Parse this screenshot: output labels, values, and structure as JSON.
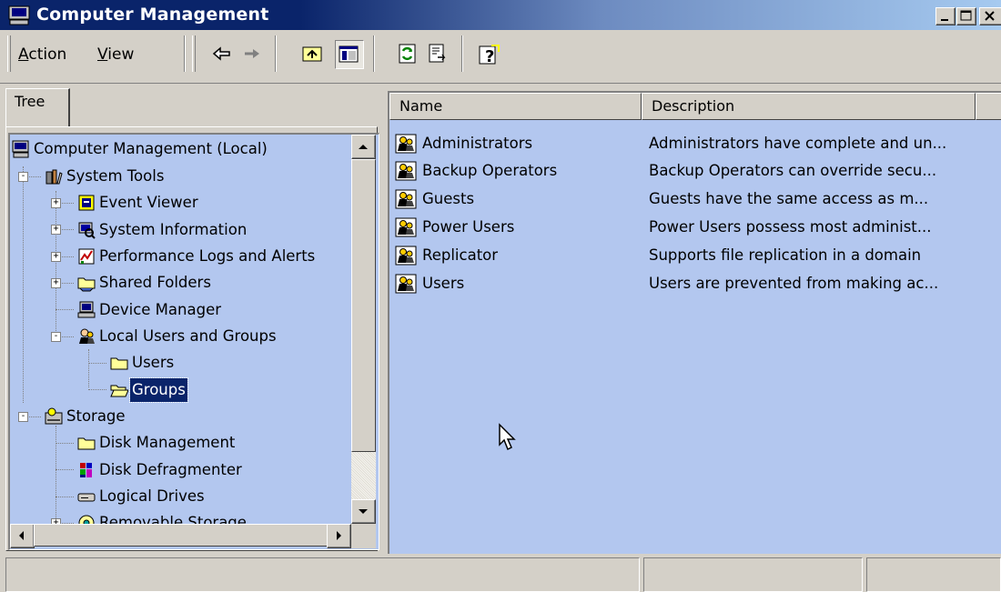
{
  "window": {
    "title": "Computer Management",
    "icon": "computer-icon",
    "caption_buttons": [
      "minimize",
      "maximize",
      "close"
    ]
  },
  "toolbar": {
    "menu": [
      {
        "label": "Action",
        "accel": "A"
      },
      {
        "label": "View",
        "accel": "V"
      }
    ],
    "buttons": [
      "back-icon",
      "forward-icon",
      "up-folder-icon",
      "show-hide-tree-icon",
      "refresh-icon",
      "export-list-icon",
      "help-icon"
    ],
    "pressed": "show-hide-tree-icon"
  },
  "tree": {
    "tab_label": "Tree",
    "items": [
      {
        "label": "Computer Management (Local)",
        "icon": "computer-icon",
        "level": 0
      },
      {
        "label": "System Tools",
        "icon": "system-tools-icon",
        "level": 1,
        "expander": "-"
      },
      {
        "label": "Event Viewer",
        "icon": "event-viewer-icon",
        "level": 2,
        "expander": "+"
      },
      {
        "label": "System Information",
        "icon": "system-information-icon",
        "level": 2,
        "expander": "+"
      },
      {
        "label": "Performance Logs and Alerts",
        "icon": "performance-logs-icon",
        "level": 2,
        "expander": "+"
      },
      {
        "label": "Shared Folders",
        "icon": "shared-folder-icon",
        "level": 2,
        "expander": "+"
      },
      {
        "label": "Device Manager",
        "icon": "device-manager-icon",
        "level": 2
      },
      {
        "label": "Local Users and Groups",
        "icon": "users-groups-icon",
        "level": 2,
        "expander": "-"
      },
      {
        "label": "Users",
        "icon": "folder-icon",
        "level": 3
      },
      {
        "label": "Groups",
        "icon": "open-folder-icon",
        "level": 3,
        "selected": true
      },
      {
        "label": "Storage",
        "icon": "storage-icon",
        "level": 1,
        "expander": "-"
      },
      {
        "label": "Disk Management",
        "icon": "folder-icon",
        "level": 2
      },
      {
        "label": "Disk Defragmenter",
        "icon": "disk-defragmenter-icon",
        "level": 2
      },
      {
        "label": "Logical Drives",
        "icon": "drive-icon",
        "level": 2
      },
      {
        "label": "Removable Storage",
        "icon": "removable-storage-icon",
        "level": 2,
        "expander": "+"
      }
    ]
  },
  "list": {
    "columns": [
      "Name",
      "Description"
    ],
    "rows": [
      {
        "name": "Administrators",
        "description": "Administrators have complete and un...",
        "icon": "group-icon"
      },
      {
        "name": "Backup Operators",
        "description": "Backup Operators can override secu...",
        "icon": "group-icon"
      },
      {
        "name": "Guests",
        "description": "Guests have the same access as m...",
        "icon": "group-icon"
      },
      {
        "name": "Power Users",
        "description": "Power Users possess most administ...",
        "icon": "group-icon"
      },
      {
        "name": "Replicator",
        "description": "Supports file replication in a domain",
        "icon": "group-icon"
      },
      {
        "name": "Users",
        "description": "Users are prevented from making ac...",
        "icon": "group-icon"
      }
    ]
  },
  "colors": {
    "title_bar": "#0a246a",
    "pane_background": "#b3c7ef",
    "selection": "#0a246a",
    "chrome": "#d4d0c8"
  }
}
